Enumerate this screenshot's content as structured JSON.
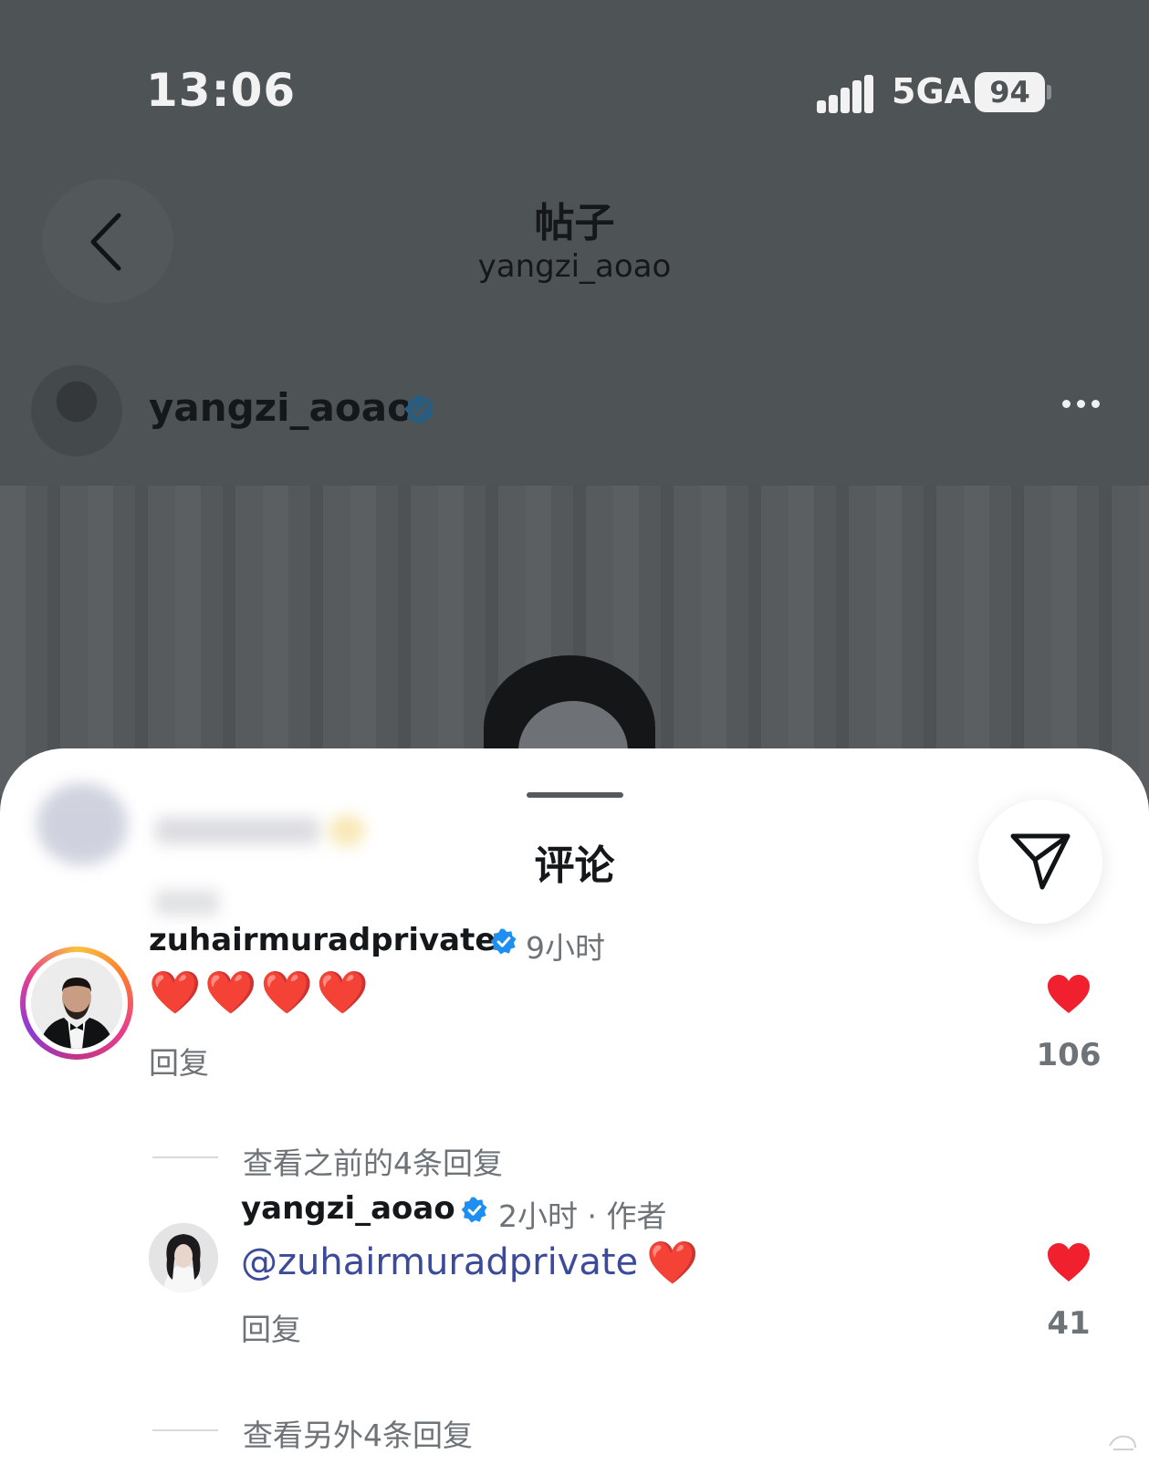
{
  "status_bar": {
    "time": "13:06",
    "network": "5GA",
    "battery": "94"
  },
  "nav": {
    "title": "帖子",
    "subtitle": "yangzi_aoao"
  },
  "post": {
    "username": "yangzi_aoao"
  },
  "sheet": {
    "title": "评论",
    "comments": [
      {
        "username": "zuhairmuradprivate",
        "time": "9小时",
        "text": "❤️❤️❤️❤️",
        "reply_label": "回复",
        "likes": "106",
        "view_replies": "查看之前的4条回复"
      }
    ],
    "reply": {
      "username": "yangzi_aoao",
      "meta": "2小时 · 作者",
      "mention": "@zuhairmuradprivate",
      "emoji": "❤️",
      "reply_label": "回复",
      "likes": "41",
      "view_more": "查看另外4条回复"
    }
  },
  "colors": {
    "verified": "#1f8ef1",
    "like": "#f0202e",
    "mention": "#3b4a9a",
    "dim_bg": "#4e5356"
  },
  "icons": [
    "back-chevron-icon",
    "verified-badge-icon",
    "more-dots-icon",
    "share-send-icon",
    "heart-icon"
  ]
}
